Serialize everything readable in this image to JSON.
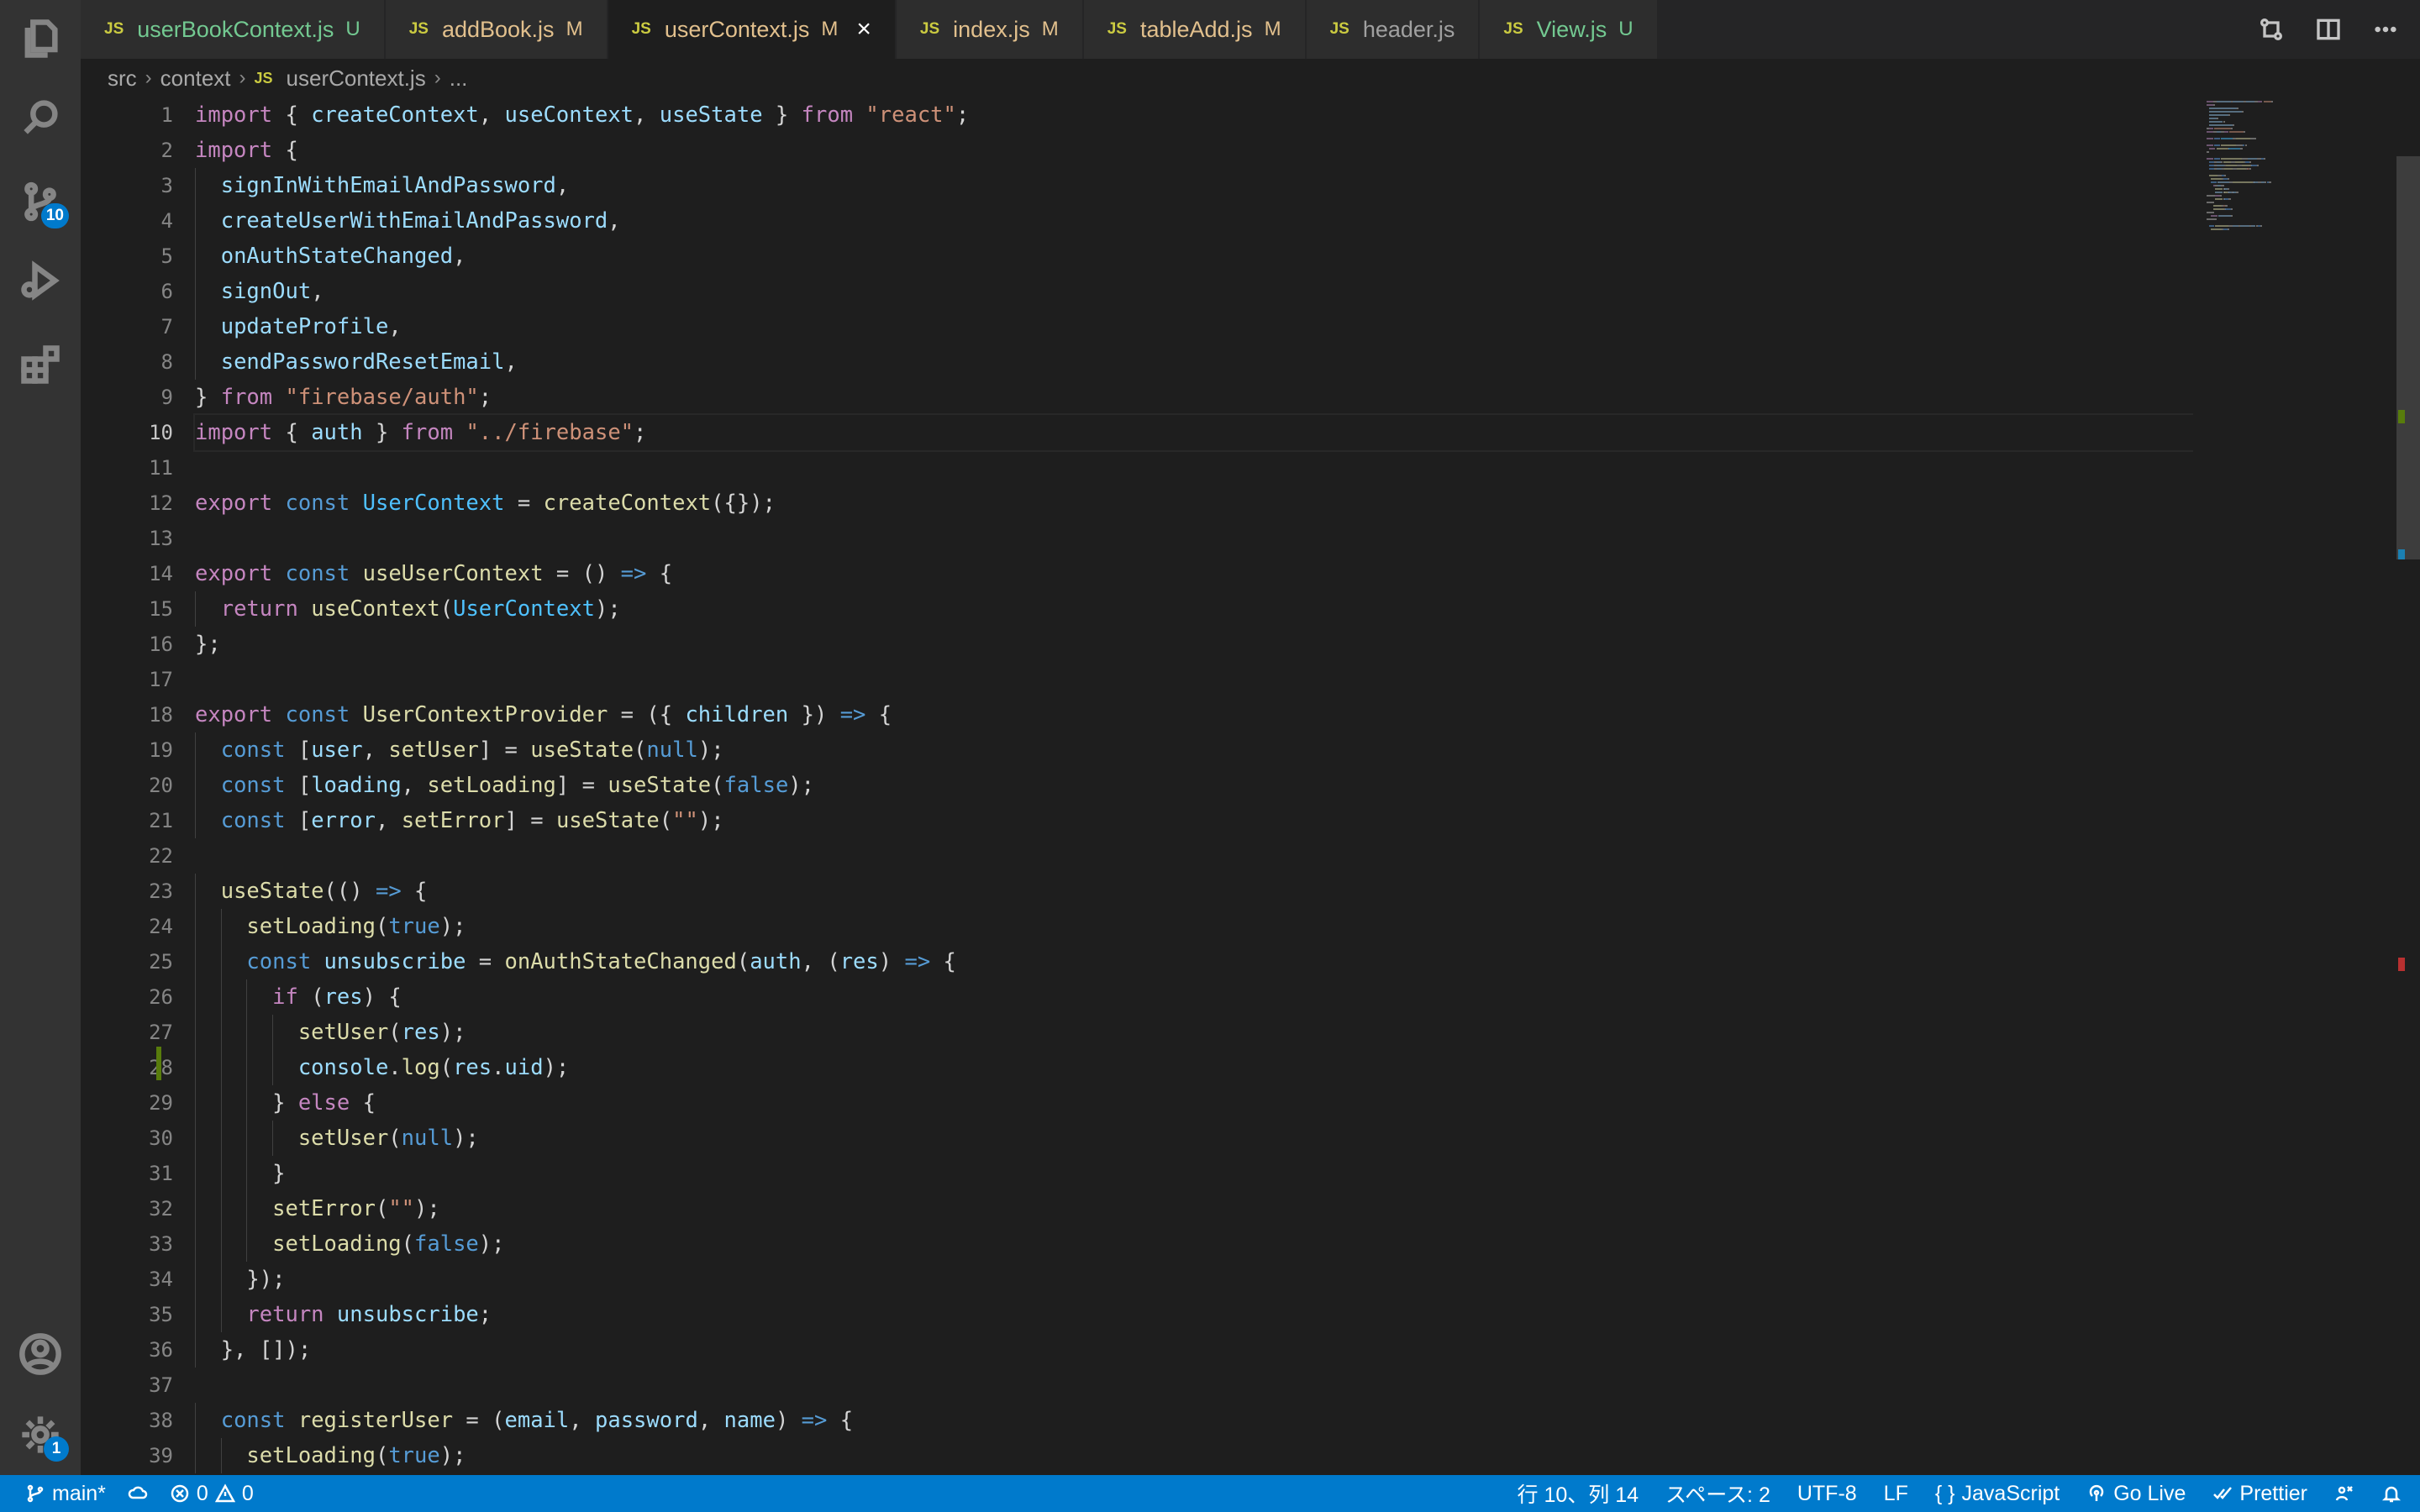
{
  "tabs": [
    {
      "icon": "JS",
      "label": "userBookContext.js",
      "status": "U",
      "kind": "untracked"
    },
    {
      "icon": "JS",
      "label": "addBook.js",
      "status": "M",
      "kind": "modified"
    },
    {
      "icon": "JS",
      "label": "userContext.js",
      "status": "M",
      "kind": "modified",
      "active": true,
      "close": "×"
    },
    {
      "icon": "JS",
      "label": "index.js",
      "status": "M",
      "kind": "modified"
    },
    {
      "icon": "JS",
      "label": "tableAdd.js",
      "status": "M",
      "kind": "modified"
    },
    {
      "icon": "JS",
      "label": "header.js",
      "status": "",
      "kind": "plain"
    },
    {
      "icon": "JS",
      "label": "View.js",
      "status": "U",
      "kind": "untracked"
    }
  ],
  "breadcrumb": {
    "part1": "src",
    "part2": "context",
    "file_icon": "JS",
    "part3": "userContext.js",
    "part4": "..."
  },
  "activity": {
    "scm_badge": "10",
    "settings_badge": "1"
  },
  "editor": {
    "current_line": 10,
    "line_numbers": [
      "1",
      "2",
      "3",
      "4",
      "5",
      "6",
      "7",
      "8",
      "9",
      "10",
      "11",
      "12",
      "13",
      "14",
      "15",
      "16",
      "17",
      "18",
      "19",
      "20",
      "21",
      "22",
      "23",
      "24",
      "25",
      "26",
      "27",
      "28",
      "29",
      "30",
      "31",
      "32",
      "33",
      "34",
      "35",
      "36",
      "37",
      "38",
      "39"
    ],
    "lines": [
      [
        [
          "k",
          "import"
        ],
        [
          "p",
          " { "
        ],
        [
          "v",
          "createContext"
        ],
        [
          "p",
          ", "
        ],
        [
          "v",
          "useContext"
        ],
        [
          "p",
          ", "
        ],
        [
          "v",
          "useState"
        ],
        [
          "p",
          " } "
        ],
        [
          "k",
          "from"
        ],
        [
          "p",
          " "
        ],
        [
          "s",
          "\"react\""
        ],
        [
          "p",
          ";"
        ]
      ],
      [
        [
          "k",
          "import"
        ],
        [
          "p",
          " {"
        ]
      ],
      [
        [
          "p",
          "  "
        ],
        [
          "v",
          "signInWithEmailAndPassword"
        ],
        [
          "p",
          ","
        ]
      ],
      [
        [
          "p",
          "  "
        ],
        [
          "v",
          "createUserWithEmailAndPassword"
        ],
        [
          "p",
          ","
        ]
      ],
      [
        [
          "p",
          "  "
        ],
        [
          "v",
          "onAuthStateChanged"
        ],
        [
          "p",
          ","
        ]
      ],
      [
        [
          "p",
          "  "
        ],
        [
          "v",
          "signOut"
        ],
        [
          "p",
          ","
        ]
      ],
      [
        [
          "p",
          "  "
        ],
        [
          "v",
          "updateProfile"
        ],
        [
          "p",
          ","
        ]
      ],
      [
        [
          "p",
          "  "
        ],
        [
          "v",
          "sendPasswordResetEmail"
        ],
        [
          "p",
          ","
        ]
      ],
      [
        [
          "p",
          "} "
        ],
        [
          "k",
          "from"
        ],
        [
          "p",
          " "
        ],
        [
          "s",
          "\"firebase/auth\""
        ],
        [
          "p",
          ";"
        ]
      ],
      [
        [
          "k",
          "import"
        ],
        [
          "p",
          " { "
        ],
        [
          "v",
          "auth"
        ],
        [
          "p",
          " } "
        ],
        [
          "k",
          "from"
        ],
        [
          "p",
          " "
        ],
        [
          "s",
          "\"../firebase\""
        ],
        [
          "p",
          ";"
        ]
      ],
      [],
      [
        [
          "k",
          "export"
        ],
        [
          "p",
          " "
        ],
        [
          "b",
          "const"
        ],
        [
          "p",
          " "
        ],
        [
          "c",
          "UserContext"
        ],
        [
          "p",
          " = "
        ],
        [
          "f",
          "createContext"
        ],
        [
          "p",
          "({});"
        ]
      ],
      [],
      [
        [
          "k",
          "export"
        ],
        [
          "p",
          " "
        ],
        [
          "b",
          "const"
        ],
        [
          "p",
          " "
        ],
        [
          "f",
          "useUserContext"
        ],
        [
          "p",
          " = () "
        ],
        [
          "b",
          "=>"
        ],
        [
          "p",
          " {"
        ]
      ],
      [
        [
          "p",
          "  "
        ],
        [
          "k",
          "return"
        ],
        [
          "p",
          " "
        ],
        [
          "f",
          "useContext"
        ],
        [
          "p",
          "("
        ],
        [
          "c",
          "UserContext"
        ],
        [
          "p",
          ");"
        ]
      ],
      [
        [
          "p",
          "};"
        ]
      ],
      [],
      [
        [
          "k",
          "export"
        ],
        [
          "p",
          " "
        ],
        [
          "b",
          "const"
        ],
        [
          "p",
          " "
        ],
        [
          "f",
          "UserContextProvider"
        ],
        [
          "p",
          " = ({ "
        ],
        [
          "v",
          "children"
        ],
        [
          "p",
          " }) "
        ],
        [
          "b",
          "=>"
        ],
        [
          "p",
          " {"
        ]
      ],
      [
        [
          "p",
          "  "
        ],
        [
          "b",
          "const"
        ],
        [
          "p",
          " ["
        ],
        [
          "v",
          "user"
        ],
        [
          "p",
          ", "
        ],
        [
          "f",
          "setUser"
        ],
        [
          "p",
          "] = "
        ],
        [
          "f",
          "useState"
        ],
        [
          "p",
          "("
        ],
        [
          "b",
          "null"
        ],
        [
          "p",
          ");"
        ]
      ],
      [
        [
          "p",
          "  "
        ],
        [
          "b",
          "const"
        ],
        [
          "p",
          " ["
        ],
        [
          "v",
          "loading"
        ],
        [
          "p",
          ", "
        ],
        [
          "f",
          "setLoading"
        ],
        [
          "p",
          "] = "
        ],
        [
          "f",
          "useState"
        ],
        [
          "p",
          "("
        ],
        [
          "b",
          "false"
        ],
        [
          "p",
          ");"
        ]
      ],
      [
        [
          "p",
          "  "
        ],
        [
          "b",
          "const"
        ],
        [
          "p",
          " ["
        ],
        [
          "v",
          "error"
        ],
        [
          "p",
          ", "
        ],
        [
          "f",
          "setError"
        ],
        [
          "p",
          "] = "
        ],
        [
          "f",
          "useState"
        ],
        [
          "p",
          "("
        ],
        [
          "s",
          "\"\""
        ],
        [
          "p",
          ");"
        ]
      ],
      [],
      [
        [
          "p",
          "  "
        ],
        [
          "f",
          "useState"
        ],
        [
          "p",
          "(() "
        ],
        [
          "b",
          "=>"
        ],
        [
          "p",
          " {"
        ]
      ],
      [
        [
          "p",
          "    "
        ],
        [
          "f",
          "setLoading"
        ],
        [
          "p",
          "("
        ],
        [
          "b",
          "true"
        ],
        [
          "p",
          ");"
        ]
      ],
      [
        [
          "p",
          "    "
        ],
        [
          "b",
          "const"
        ],
        [
          "p",
          " "
        ],
        [
          "v",
          "unsubscribe"
        ],
        [
          "p",
          " = "
        ],
        [
          "f",
          "onAuthStateChanged"
        ],
        [
          "p",
          "("
        ],
        [
          "v",
          "auth"
        ],
        [
          "p",
          ", ("
        ],
        [
          "v",
          "res"
        ],
        [
          "p",
          ") "
        ],
        [
          "b",
          "=>"
        ],
        [
          "p",
          " {"
        ]
      ],
      [
        [
          "p",
          "      "
        ],
        [
          "k",
          "if"
        ],
        [
          "p",
          " ("
        ],
        [
          "v",
          "res"
        ],
        [
          "p",
          ") {"
        ]
      ],
      [
        [
          "p",
          "        "
        ],
        [
          "f",
          "setUser"
        ],
        [
          "p",
          "("
        ],
        [
          "v",
          "res"
        ],
        [
          "p",
          ");"
        ]
      ],
      [
        [
          "p",
          "        "
        ],
        [
          "v",
          "console"
        ],
        [
          "p",
          "."
        ],
        [
          "f",
          "log"
        ],
        [
          "p",
          "("
        ],
        [
          "v",
          "res"
        ],
        [
          "p",
          "."
        ],
        [
          "v",
          "uid"
        ],
        [
          "p",
          ");"
        ]
      ],
      [
        [
          "p",
          "      } "
        ],
        [
          "k",
          "else"
        ],
        [
          "p",
          " {"
        ]
      ],
      [
        [
          "p",
          "        "
        ],
        [
          "f",
          "setUser"
        ],
        [
          "p",
          "("
        ],
        [
          "b",
          "null"
        ],
        [
          "p",
          ");"
        ]
      ],
      [
        [
          "p",
          "      }"
        ]
      ],
      [
        [
          "p",
          "      "
        ],
        [
          "f",
          "setError"
        ],
        [
          "p",
          "("
        ],
        [
          "s",
          "\"\""
        ],
        [
          "p",
          ");"
        ]
      ],
      [
        [
          "p",
          "      "
        ],
        [
          "f",
          "setLoading"
        ],
        [
          "p",
          "("
        ],
        [
          "b",
          "false"
        ],
        [
          "p",
          ");"
        ]
      ],
      [
        [
          "p",
          "    });"
        ]
      ],
      [
        [
          "p",
          "    "
        ],
        [
          "k",
          "return"
        ],
        [
          "p",
          " "
        ],
        [
          "v",
          "unsubscribe"
        ],
        [
          "p",
          ";"
        ]
      ],
      [
        [
          "p",
          "  }, []);"
        ]
      ],
      [],
      [
        [
          "p",
          "  "
        ],
        [
          "b",
          "const"
        ],
        [
          "p",
          " "
        ],
        [
          "f",
          "registerUser"
        ],
        [
          "p",
          " = ("
        ],
        [
          "v",
          "email"
        ],
        [
          "p",
          ", "
        ],
        [
          "v",
          "password"
        ],
        [
          "p",
          ", "
        ],
        [
          "v",
          "name"
        ],
        [
          "p",
          ") "
        ],
        [
          "b",
          "=>"
        ],
        [
          "p",
          " {"
        ]
      ],
      [
        [
          "p",
          "    "
        ],
        [
          "f",
          "setLoading"
        ],
        [
          "p",
          "("
        ],
        [
          "b",
          "true"
        ],
        [
          "p",
          ");"
        ]
      ]
    ]
  },
  "statusbar": {
    "branch": "main*",
    "errors": "0",
    "warnings": "0",
    "position": "行 10、列 14",
    "spaces": "スペース: 2",
    "encoding": "UTF-8",
    "eol": "LF",
    "language_icon": "{ }",
    "language": "JavaScript",
    "golive": "Go Live",
    "prettier": "Prettier"
  },
  "colors": {
    "accent": "#007acc",
    "modified": "#e2c08d",
    "untracked": "#73c991",
    "js_icon": "#cbcb41"
  }
}
